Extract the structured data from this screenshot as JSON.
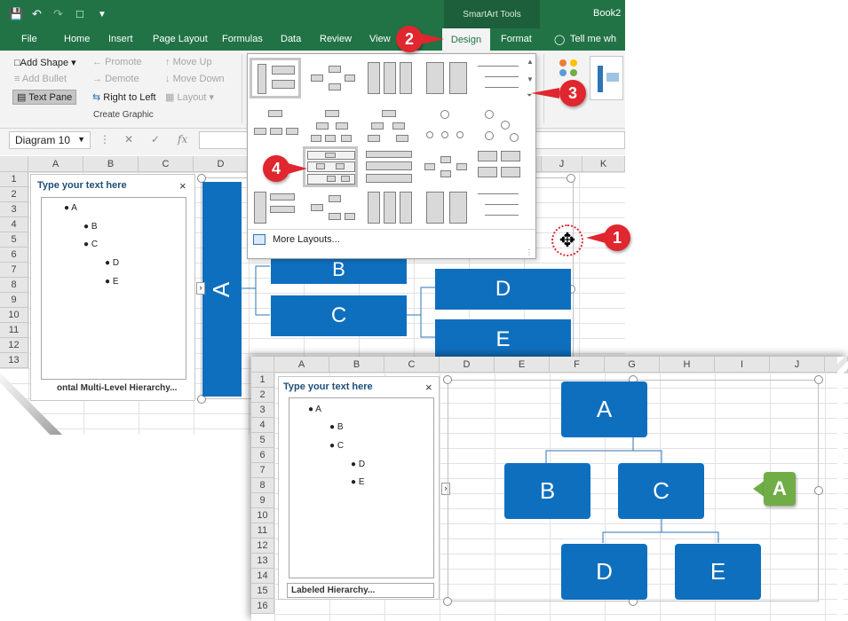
{
  "window": {
    "contextual_tab_group": "SmartArt Tools",
    "doc_title": "Book2"
  },
  "ribbon_tabs": [
    "File",
    "Home",
    "Insert",
    "Page Layout",
    "Formulas",
    "Data",
    "Review",
    "View",
    "Design",
    "Format",
    "Tell me wh"
  ],
  "create_graphic": {
    "add_shape": "Add Shape",
    "add_bullet": "Add Bullet",
    "text_pane": "Text Pane",
    "promote": "Promote",
    "demote": "Demote",
    "right_to_left": "Right to Left",
    "move_up": "Move Up",
    "move_down": "Move Down",
    "layout": "Layout",
    "group_label": "Create Graphic"
  },
  "formula_bar": {
    "name_box": "Diagram 10",
    "fx": "fx"
  },
  "back_sheet": {
    "columns": [
      "A",
      "B",
      "C",
      "D",
      "J",
      "K"
    ],
    "rows": [
      "1",
      "2",
      "3",
      "4",
      "5",
      "6",
      "7",
      "8",
      "9",
      "10",
      "11",
      "12",
      "13"
    ]
  },
  "text_pane_back": {
    "title": "Type your text here",
    "close": "×",
    "items": [
      "A",
      "B",
      "C",
      "D",
      "E"
    ],
    "footer": "ontal Multi-Level Hierarchy..."
  },
  "smartart_back": {
    "a": "A",
    "b": "B",
    "c": "C",
    "d": "D",
    "e": "E"
  },
  "gallery": {
    "more_layouts": "More Layouts..."
  },
  "callouts": [
    "1",
    "2",
    "3",
    "4"
  ],
  "front_sheet": {
    "columns": [
      "A",
      "B",
      "C",
      "D",
      "E",
      "F",
      "G",
      "H",
      "I",
      "J"
    ],
    "rows": [
      "1",
      "2",
      "3",
      "4",
      "5",
      "6",
      "7",
      "8",
      "9",
      "10",
      "11",
      "12",
      "13",
      "14",
      "15",
      "16"
    ]
  },
  "text_pane_front": {
    "title": "Type your text here",
    "close": "×",
    "items": [
      "A",
      "B",
      "C",
      "D",
      "E"
    ],
    "footer": "Labeled Hierarchy..."
  },
  "smartart_front": {
    "a": "A",
    "b": "B",
    "c": "C",
    "d": "D",
    "e": "E"
  },
  "badge": "A",
  "colors": {
    "excel_green": "#217346",
    "shape_blue": "#0f6fbf",
    "callout_red": "#e0262e",
    "badge_green": "#70ad47"
  }
}
